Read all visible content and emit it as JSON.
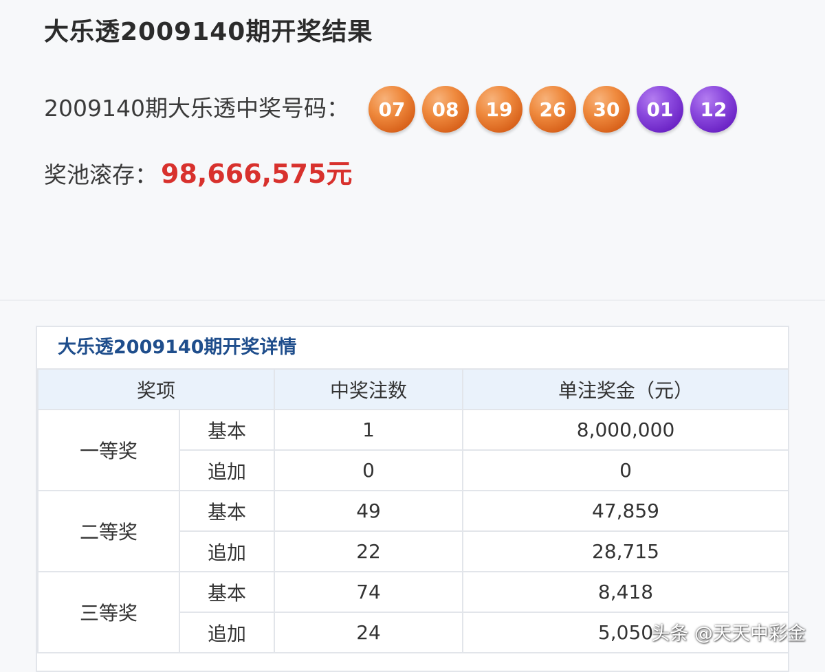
{
  "header": {
    "title": "大乐透2009140期开奖结果",
    "numbers_label": "2009140期大乐透中奖号码：",
    "red_balls": [
      "07",
      "08",
      "19",
      "26",
      "30"
    ],
    "blue_balls": [
      "01",
      "12"
    ],
    "pool_label": "奖池滚存：",
    "pool_value": "98,666,575元"
  },
  "details": {
    "title": "大乐透2009140期开奖详情",
    "columns": [
      "奖项",
      "中奖注数",
      "单注奖金（元）"
    ],
    "groups": [
      {
        "name": "一等奖",
        "rows": [
          {
            "type": "基本",
            "count": "1",
            "amount": "8,000,000"
          },
          {
            "type": "追加",
            "count": "0",
            "amount": "0"
          }
        ]
      },
      {
        "name": "二等奖",
        "rows": [
          {
            "type": "基本",
            "count": "49",
            "amount": "47,859"
          },
          {
            "type": "追加",
            "count": "22",
            "amount": "28,715"
          }
        ]
      },
      {
        "name": "三等奖",
        "rows": [
          {
            "type": "基本",
            "count": "74",
            "amount": "8,418"
          },
          {
            "type": "追加",
            "count": "24",
            "amount": "5,050"
          }
        ]
      }
    ]
  },
  "watermark": "头条 @天天中彩金",
  "colors": {
    "red_ball": "#e0732a",
    "blue_ball": "#7a3ad4",
    "pool_value": "#d8312d",
    "details_title": "#1f4e8c",
    "table_header_bg": "#eaf2fb"
  }
}
